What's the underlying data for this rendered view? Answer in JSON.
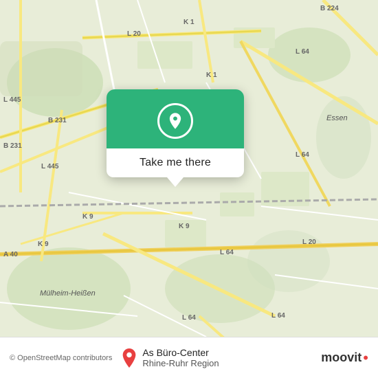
{
  "map": {
    "attribution": "© OpenStreetMap contributors",
    "accent_color": "#2db37a",
    "bg_color": "#e8edd8"
  },
  "popup": {
    "button_label": "Take me there",
    "icon": "location-pin"
  },
  "bottom_bar": {
    "location_name": "As Büro-Center",
    "location_region": "Rhine-Ruhr Region",
    "brand": "moovit",
    "attribution": "© OpenStreetMap contributors"
  },
  "road_labels": [
    "L 445",
    "B 231",
    "L 445",
    "B 231",
    "A 40",
    "K 9",
    "K 9",
    "L 20",
    "K 1",
    "K 1",
    "L 64",
    "L 64",
    "K 9",
    "L 64",
    "L 20",
    "L 64",
    "L 20",
    "B 224",
    "L 64",
    "Essen",
    "Mülheim-Heißen"
  ]
}
